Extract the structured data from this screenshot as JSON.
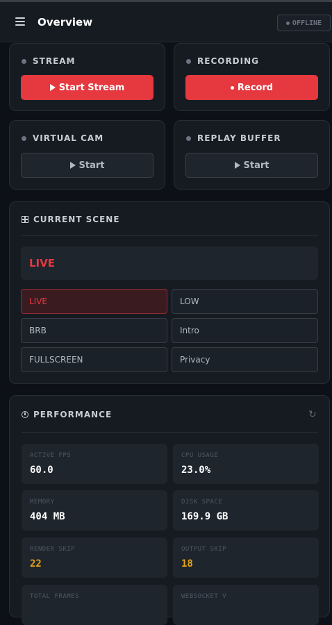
{
  "header": {
    "title": "Overview",
    "status": "OFFLINE"
  },
  "controls": {
    "stream": {
      "label": "STREAM",
      "button": "Start Stream"
    },
    "recording": {
      "label": "RECORDING",
      "button": "Record"
    },
    "virtual_cam": {
      "label": "VIRTUAL CAM",
      "button": "Start"
    },
    "replay_buffer": {
      "label": "REPLAY BUFFER",
      "button": "Start"
    }
  },
  "scene": {
    "title": "CURRENT SCENE",
    "current": "LIVE",
    "options": [
      "LIVE",
      "LOW",
      "BRB",
      "Intro",
      "FULLSCREEN",
      "Privacy"
    ],
    "active_index": 0
  },
  "performance": {
    "title": "PERFORMANCE",
    "stats": [
      {
        "label": "ACTIVE FPS",
        "value": "60.0"
      },
      {
        "label": "CPU USAGE",
        "value": "23.0%"
      },
      {
        "label": "MEMORY",
        "value": "404 MB"
      },
      {
        "label": "DISK SPACE",
        "value": "169.9 GB"
      },
      {
        "label": "RENDER SKIP",
        "value": "22"
      },
      {
        "label": "OUTPUT SKIP",
        "value": "18"
      },
      {
        "label": "TOTAL FRAMES",
        "value": ""
      },
      {
        "label": "WEBSOCKET V",
        "value": ""
      }
    ]
  },
  "colors": {
    "accent": "#e5383f",
    "warning": "#e3a317",
    "background": "#0d1117",
    "card": "#161b22"
  },
  "icons": {
    "menu": "hamburger-icon",
    "scene": "grid-icon",
    "performance": "clock-icon",
    "refresh": "refresh-icon"
  }
}
